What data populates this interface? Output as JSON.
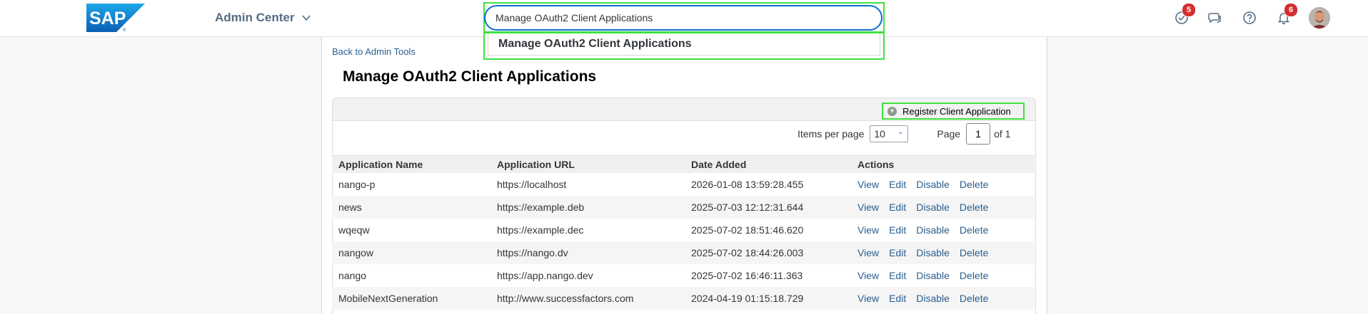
{
  "shell": {
    "app_title": "Admin Center",
    "search_value": "Manage OAuth2 Client Applications",
    "todo_badge": "5",
    "notifications_badge": "6"
  },
  "suggestions": [
    "Manage OAuth2 Client Applications"
  ],
  "content": {
    "back_link": "Back to Admin Tools",
    "title": "Manage OAuth2 Client Applications",
    "register_button": "Register Client Application",
    "items_per_page_label": "Items per page",
    "items_per_page_value": "10",
    "page_label": "Page",
    "page_value": "1",
    "page_of": "of 1"
  },
  "table": {
    "headers": [
      "Application Name",
      "Application URL",
      "Date Added",
      "Actions"
    ],
    "actions": [
      "View",
      "Edit",
      "Disable",
      "Delete"
    ],
    "rows": [
      {
        "name": "nango-p",
        "url": "https://localhost",
        "date": "2026-01-08 13:59:28.455"
      },
      {
        "name": "news",
        "url": "https://example.deb",
        "date": "2025-07-03 12:12:31.644"
      },
      {
        "name": "wqeqw",
        "url": "https://example.dec",
        "date": "2025-07-02 18:51:46.620"
      },
      {
        "name": "nangow",
        "url": "https://nango.dv",
        "date": "2025-07-02 18:44:26.003"
      },
      {
        "name": "nango",
        "url": "https://app.nango.dev",
        "date": "2025-07-02 16:46:11.363"
      },
      {
        "name": "MobileNextGeneration",
        "url": "http://www.successfactors.com",
        "date": "2024-04-19 01:15:18.729"
      }
    ]
  },
  "colors": {
    "brand_blue": "#0a6ed1",
    "link": "#2a5f8f",
    "highlight": "#3fe23f",
    "badge": "#d32f2f"
  },
  "icons": {
    "todo": "checkmark-circle-icon",
    "feedback": "chat-icon",
    "help": "question-icon",
    "notifications": "bell-icon"
  }
}
